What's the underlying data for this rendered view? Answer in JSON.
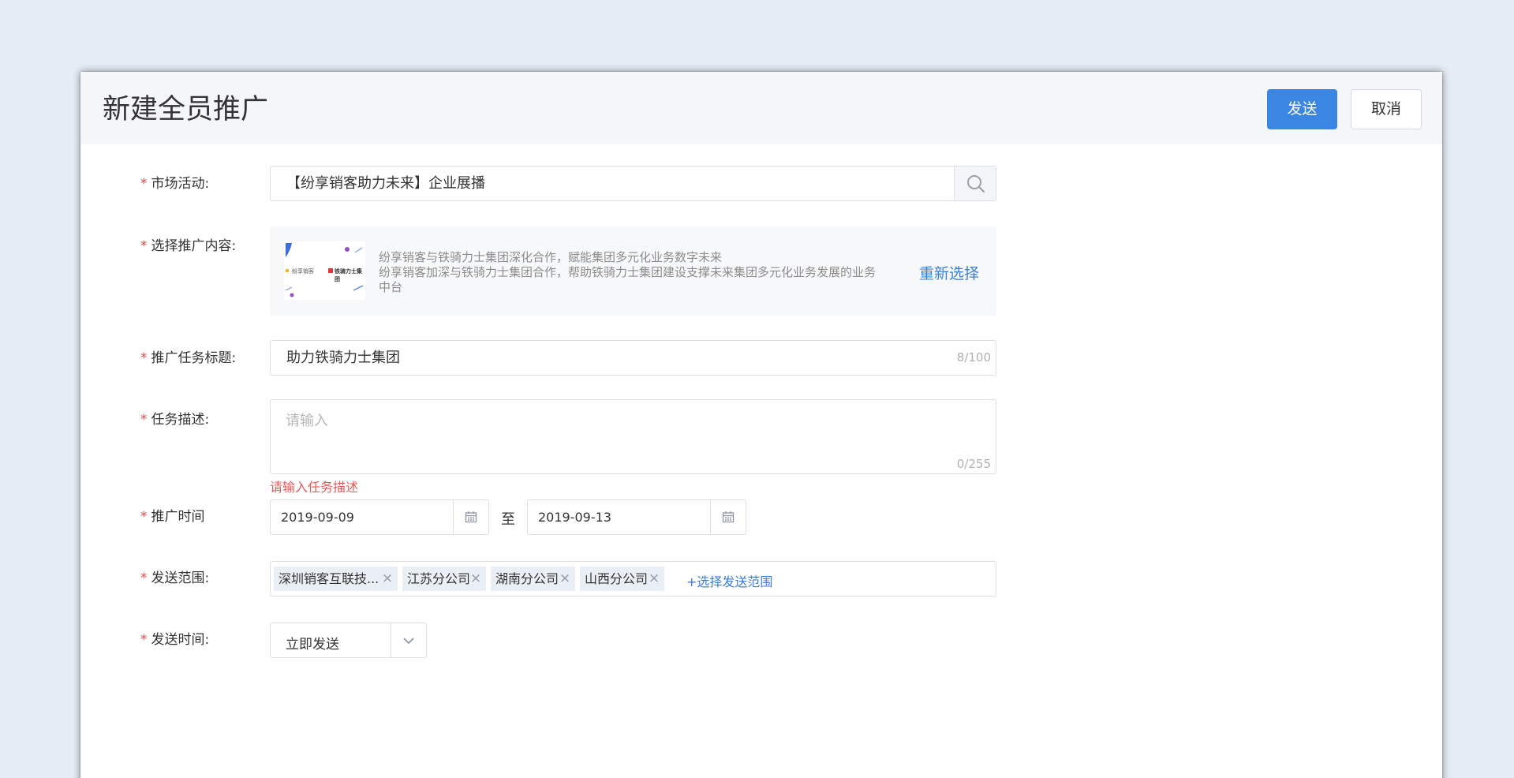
{
  "dialog": {
    "title": "新建全员推广",
    "send_label": "发送",
    "cancel_label": "取消"
  },
  "form": {
    "campaign": {
      "label": "市场活动:",
      "value": "【纷享销客助力未来】企业展播"
    },
    "content": {
      "label": "选择推广内容:",
      "line1": "纷享销客与铁骑力士集团深化合作，赋能集团多元化业务数字未来",
      "line2": "纷享销客加深与铁骑力士集团合作，帮助铁骑力士集团建设支撑未来集团多元化业务发展的业务",
      "line3": "中台",
      "reselect_label": "重新选择",
      "thumb_logo_left": "纷享销客",
      "thumb_logo_right": "铁骑力士集团"
    },
    "task_title": {
      "label": "推广任务标题:",
      "value": "助力铁骑力士集团",
      "counter": "8/100"
    },
    "task_desc": {
      "label": "任务描述:",
      "placeholder": "请输入",
      "counter": "0/255",
      "error": "请输入任务描述"
    },
    "promo_time": {
      "label": "推广时间",
      "start": "2019-09-09",
      "separator": "至",
      "end": "2019-09-13"
    },
    "scope": {
      "label": "发送范围:",
      "tags": [
        "深圳销客互联技...",
        "江苏分公司",
        "湖南分公司",
        "山西分公司"
      ],
      "add_label": "+选择发送范围"
    },
    "send_time": {
      "label": "发送时间:",
      "value": "立即发送"
    }
  },
  "colors": {
    "primary": "#3b86e3",
    "link": "#3b7fd9",
    "required": "#e24b4b",
    "error": "#e85a5a"
  }
}
